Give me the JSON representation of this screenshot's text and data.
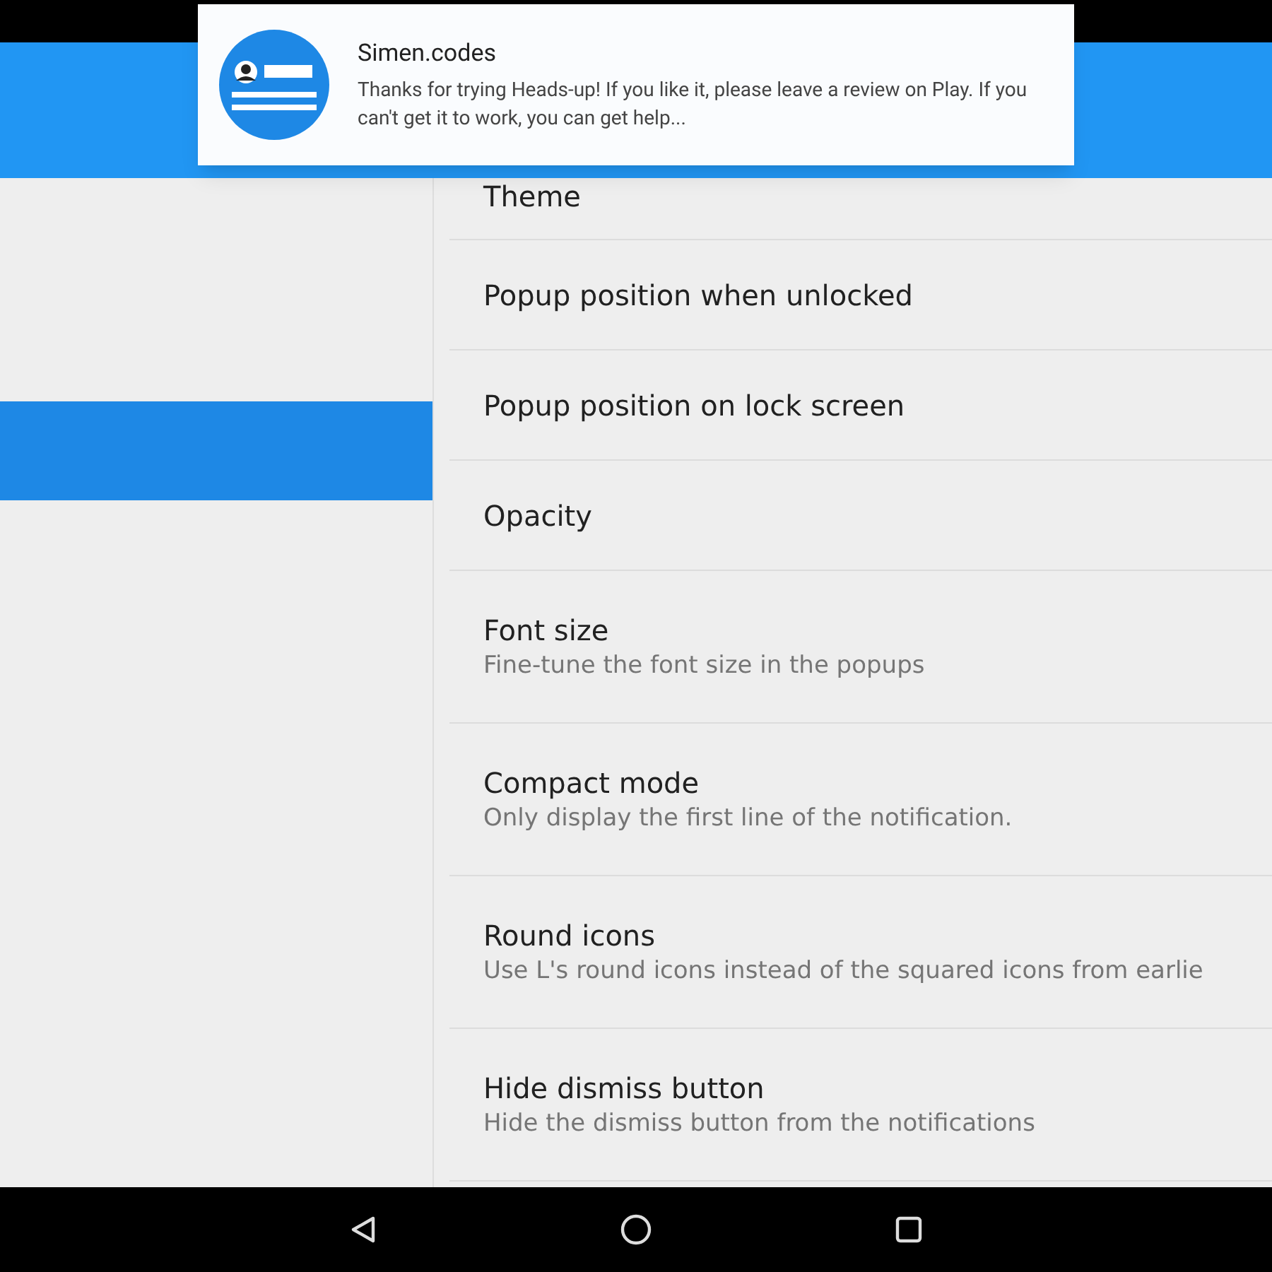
{
  "settings": [
    {
      "title": "Theme"
    },
    {
      "title": "Popup position when unlocked"
    },
    {
      "title": "Popup position on lock screen"
    },
    {
      "title": "Opacity"
    },
    {
      "title": "Font size",
      "subtitle": "Fine-tune the font size in the popups"
    },
    {
      "title": "Compact mode",
      "subtitle": "Only display the first line of the notification."
    },
    {
      "title": "Round icons",
      "subtitle": "Use L's round icons instead of the squared icons from earlie"
    },
    {
      "title": "Hide dismiss button",
      "subtitle": "Hide the dismiss button from the notifications"
    }
  ],
  "notification": {
    "title": "Simen.codes",
    "text": "Thanks for trying Heads-up! If you like it, please leave a review on Play. If you can't get it to work, you can get help..."
  }
}
